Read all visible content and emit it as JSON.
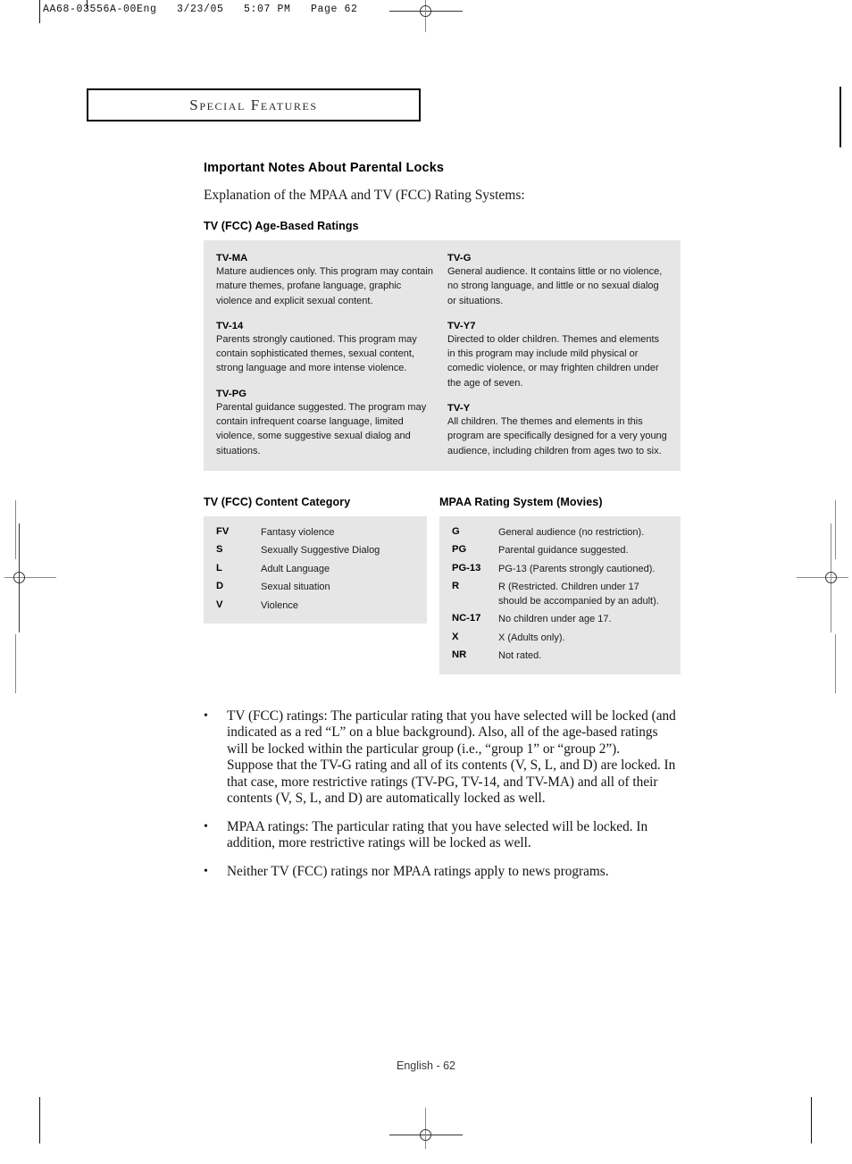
{
  "prepress": {
    "header_line": "AA68-03556A-00Eng   3/23/05   5:07 PM   Page 62"
  },
  "section_banner": {
    "label": "Special Features"
  },
  "page": {
    "title": "Important Notes About Parental Locks",
    "intro": "Explanation of the MPAA and TV (FCC) Rating Systems:",
    "footer": "English - 62"
  },
  "age_based": {
    "heading": "TV (FCC) Age-Based Ratings",
    "left_column": [
      {
        "code": "TV-MA",
        "desc": "Mature audiences only. This program may contain mature themes, profane language, graphic violence and explicit sexual content."
      },
      {
        "code": "TV-14",
        "desc": "Parents strongly cautioned. This program may contain sophisticated themes, sexual content, strong language and more intense violence."
      },
      {
        "code": "TV-PG",
        "desc": "Parental guidance suggested. The program may contain infrequent coarse language, limited violence, some suggestive sexual dialog and situations."
      }
    ],
    "right_column": [
      {
        "code": "TV-G",
        "desc": "General audience.  It contains little or no violence, no strong language, and little or no sexual dialog or situations."
      },
      {
        "code": "TV-Y7",
        "desc": "Directed to older children. Themes and elements in this program may include mild physical or comedic violence, or may frighten children under the age of seven."
      },
      {
        "code": "TV-Y",
        "desc": "All children. The themes and elements in this program are specifically designed for a very young audience, including children from ages two to six."
      }
    ]
  },
  "content_category": {
    "heading": "TV (FCC) Content Category",
    "rows": [
      {
        "code": "FV",
        "desc": "Fantasy violence"
      },
      {
        "code": "S",
        "desc": "Sexually Suggestive Dialog"
      },
      {
        "code": "L",
        "desc": "Adult Language"
      },
      {
        "code": "D",
        "desc": "Sexual situation"
      },
      {
        "code": "V",
        "desc": "Violence"
      }
    ]
  },
  "mpaa": {
    "heading": "MPAA Rating System (Movies)",
    "rows": [
      {
        "code": "G",
        "desc": "General audience (no restriction)."
      },
      {
        "code": "PG",
        "desc": "Parental guidance suggested."
      },
      {
        "code": "PG-13",
        "desc": "PG-13 (Parents strongly cautioned)."
      },
      {
        "code": "R",
        "desc": "R (Restricted. Children under 17 should be accompanied by an adult)."
      },
      {
        "code": "NC-17",
        "desc": "No children under age 17."
      },
      {
        "code": "X",
        "desc": "X (Adults only)."
      },
      {
        "code": "NR",
        "desc": "Not rated."
      }
    ]
  },
  "notes": {
    "bullet_marker": "•",
    "items": [
      {
        "paragraphs": [
          "TV (FCC) ratings: The particular rating that you have selected will be locked (and indicated as a red “L” on a blue background). Also, all of the age-based ratings will be locked within the particular group (i.e., “group 1” or “group 2”).",
          "Suppose that the TV-G rating and all of its contents (V, S, L, and D) are locked. In that case, more restrictive ratings (TV-PG, TV-14, and TV-MA) and all of their contents (V, S, L, and D) are automatically locked as well."
        ]
      },
      {
        "paragraphs": [
          "MPAA ratings: The particular rating that you have selected will be locked. In addition, more restrictive ratings will be locked as well."
        ]
      },
      {
        "paragraphs": [
          "Neither TV (FCC) ratings nor MPAA ratings apply to news programs."
        ]
      }
    ]
  },
  "colors": {
    "panel_background": "#e6e6e6",
    "text": "#000000",
    "reg_mark": "#333333"
  }
}
